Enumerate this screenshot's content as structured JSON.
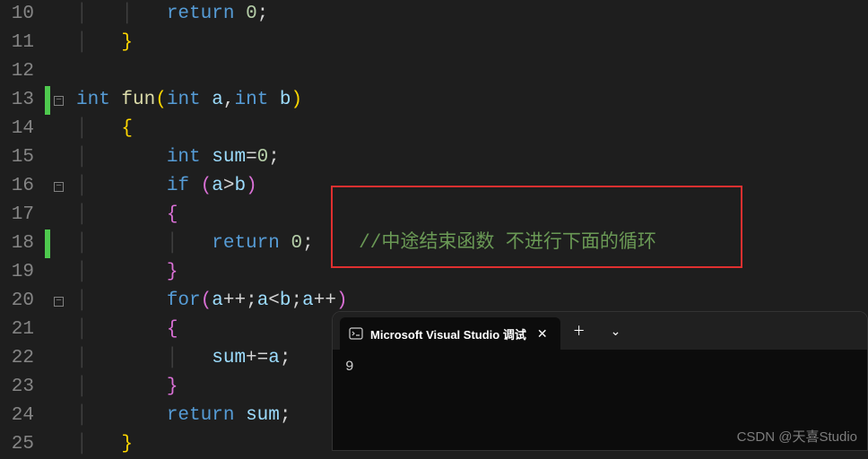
{
  "gutter": {
    "lines": [
      "10",
      "11",
      "12",
      "13",
      "14",
      "15",
      "16",
      "17",
      "18",
      "19",
      "20",
      "21",
      "22",
      "23",
      "24",
      "25"
    ]
  },
  "code": {
    "l10": {
      "kw": "return",
      "num": "0",
      "semi": ";"
    },
    "l13": {
      "kw1": "int",
      "fn": "fun",
      "lp": "(",
      "kw2": "int",
      "p1": "a",
      "comma": ",",
      "kw3": "int",
      "p2": "b",
      "rp": ")"
    },
    "l15": {
      "kw": "int",
      "id": "sum",
      "eq": "=",
      "num": "0",
      "semi": ";"
    },
    "l16": {
      "kw": "if",
      "lp": "(",
      "a": "a",
      "op": ">",
      "b": "b",
      "rp": ")"
    },
    "l18": {
      "kw": "return",
      "num": "0",
      "semi": ";",
      "cmt": "//中途结束函数 不进行下面的循环"
    },
    "l20": {
      "kw": "for",
      "lp": "(",
      "a1": "a",
      "op1": "++",
      "s1": ";",
      "a2": "a",
      "op2": "<",
      "b": "b",
      "s2": ";",
      "a3": "a",
      "op3": "++",
      "rp": ")"
    },
    "l22": {
      "id": "sum",
      "op": "+=",
      "a": "a",
      "semi": ";"
    },
    "l24": {
      "kw": "return",
      "id": "sum",
      "semi": ";"
    }
  },
  "terminal": {
    "tab_title": "Microsoft Visual Studio 调试",
    "output": "9"
  },
  "watermark": "CSDN @天喜Studio",
  "fold": {
    "minus": "−"
  }
}
